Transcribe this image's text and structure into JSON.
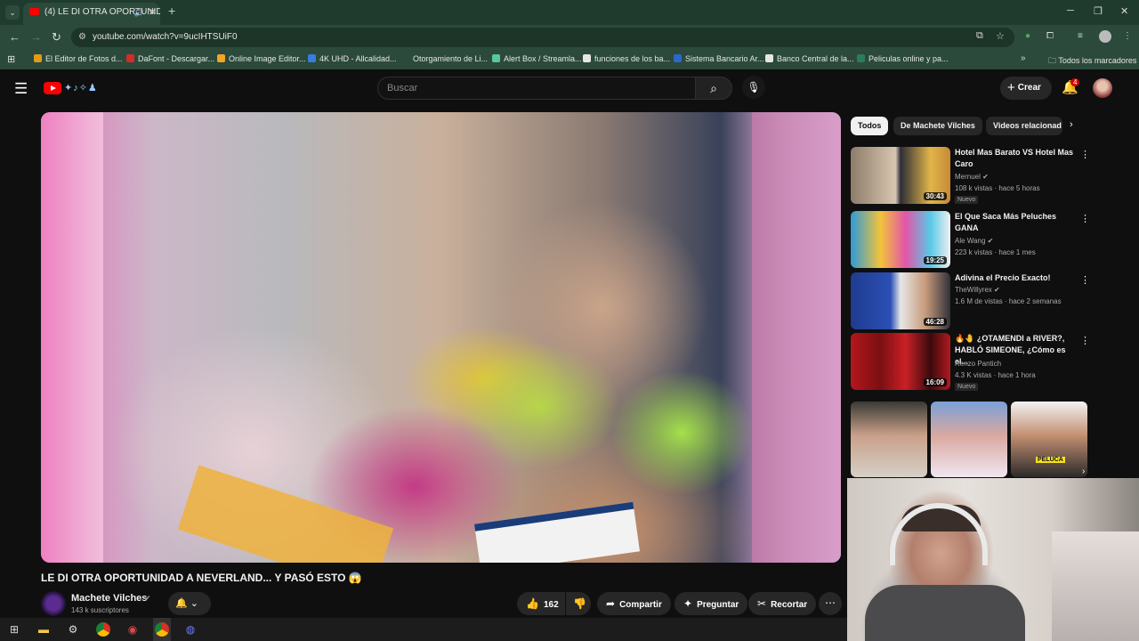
{
  "browser": {
    "tab_title": "(4) LE DI OTRA OPORTUNID",
    "url": "youtube.com/watch?v=9ucIHTSUiF0",
    "bookmarks": [
      {
        "label": "El Editor de Fotos d...",
        "color": "#e39a1b"
      },
      {
        "label": "DaFont - Descargar...",
        "color": "#d42b2b"
      },
      {
        "label": "Online Image Editor...",
        "color": "#f2a623"
      },
      {
        "label": "4K UHD - Allcalidad...",
        "color": "#3a7be0"
      },
      {
        "label": "Otorgamiento de Li...",
        "color": "#2b4a3b"
      },
      {
        "label": "Alert Box / Streamla...",
        "color": "#59c6a1"
      },
      {
        "label": "funciones de los ba...",
        "color": "#e6e6e6"
      },
      {
        "label": "Sistema Bancario Ar...",
        "color": "#2f66c9"
      },
      {
        "label": "Banco Central de la...",
        "color": "#e6e6e6"
      },
      {
        "label": "Peliculas online y pa...",
        "color": "#2b7d5a"
      }
    ],
    "all_bookmarks": "Todos los marcadores"
  },
  "masthead": {
    "search_placeholder": "Buscar",
    "create_label": "Crear",
    "notifications_count": "4"
  },
  "video": {
    "title": "LE DI OTRA OPORTUNIDAD A NEVERLAND... Y PASÓ ESTO 😱",
    "channel": "Machete Vilches",
    "subscribers": "143 k suscriptores",
    "likes": "162",
    "actions": {
      "share": "Compartir",
      "ask": "Preguntar",
      "clip": "Recortar"
    }
  },
  "chips": [
    "Todos",
    "De Machete Vilches",
    "Videos relacionad"
  ],
  "recommendations": [
    {
      "title": "Hotel Mas Barato VS Hotel Mas Caro",
      "channel": "Mernuel",
      "meta": "108 k vistas · hace 5 horas",
      "duration": "30:43",
      "badge": "Nuevo",
      "thumb": "linear-gradient(90deg,#8d7c6a,#d8c6b0 45%,#2e2e38 50%,#e2b54a 80%,#c58a36)"
    },
    {
      "title": "El Que Saca Más Peluches GANA",
      "channel": "Ale Wang",
      "meta": "223 k vistas · hace 1 mes",
      "duration": "19:25",
      "badge": "",
      "thumb": "linear-gradient(90deg,#2f9ad8,#f3c43a 30%,#e255a8 55%,#58c9e8 80%,#f0f0f0)"
    },
    {
      "title": "Adivina el Precio Exacto!",
      "channel": "TheWillyrex",
      "meta": "1.6 M de vistas · hace 2 semanas",
      "duration": "46:28",
      "badge": "",
      "thumb": "linear-gradient(90deg,#1f3b8f,#2b4fb5 40%,#e7e7e7 50%,#c79a7a 75%,#30303a)"
    },
    {
      "title": "🔥🤚 ¿OTAMENDI a RIVER?, HABLÓ SIMEONE, ¿Cómo es el...",
      "channel": "Renzo Pantich",
      "meta": "4.3 K vistas · hace 1 hora",
      "duration": "16:09",
      "badge": "Nuevo",
      "thumb": "linear-gradient(90deg,#b5161b,#7a1012 30%,#c92026 55%,#3b0a0c 80%,#b01a1f)"
    }
  ],
  "shorts_thumbs": [
    "linear-gradient(180deg,#3a3a34,#c9a08a 45%,#d6d0c6)",
    "linear-gradient(180deg,#7aa0d8,#d9a8a0 45%,#f0e6f0)",
    "linear-gradient(180deg,#f2f2f2,#c38f72 45%,#2a2a2a)"
  ],
  "shorts_caption": "PELUCA"
}
